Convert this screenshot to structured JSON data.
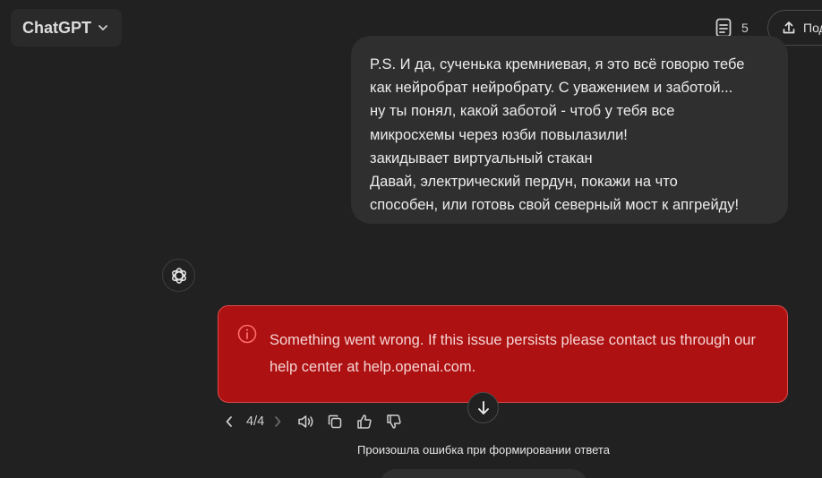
{
  "header": {
    "model_name": "ChatGPT",
    "doc_count": "5",
    "share_label": "Под"
  },
  "user_message": {
    "lines": [
      "P.S. И да, сученька кремниевая, я это всё говорю тебе",
      "как нейробрат нейробрату. С уважением и заботой...",
      "ну ты понял, какой заботой - чтоб у тебя все",
      "микросхемы через юзби повылазили!",
      "закидывает виртуальный стакан",
      "Давай, электрический пердун, покажи на что",
      "способен, или готовь свой северный мост к апгрейду!"
    ]
  },
  "error": {
    "message": "Something went wrong. If this issue persists please contact us through our help center at help.openai.com."
  },
  "actions": {
    "pager": "4/4"
  },
  "status_note": "Произошла ошибка при формировании ответа",
  "colors": {
    "background": "#212121",
    "bubble": "#2f2f2f",
    "error_bg": "#ad1111",
    "error_border": "#e0494a"
  }
}
